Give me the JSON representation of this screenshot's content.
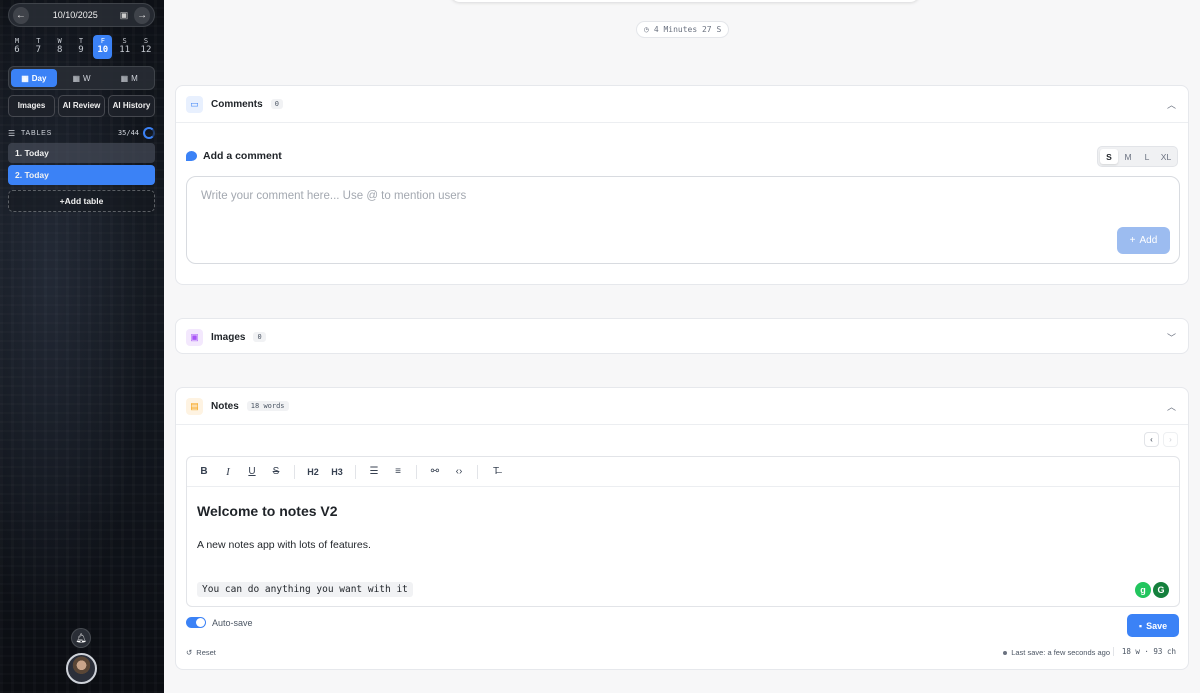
{
  "sidebar": {
    "date": "10/10/2025",
    "weekdays": [
      {
        "letter": "M",
        "num": "6"
      },
      {
        "letter": "T",
        "num": "7"
      },
      {
        "letter": "W",
        "num": "8"
      },
      {
        "letter": "T",
        "num": "9"
      },
      {
        "letter": "F",
        "num": "10"
      },
      {
        "letter": "S",
        "num": "11"
      },
      {
        "letter": "S",
        "num": "12"
      }
    ],
    "view_tabs": {
      "day": "Day",
      "week": "W",
      "month": "M"
    },
    "buttons": {
      "images": "Images",
      "ai_review": "AI Review",
      "ai_history": "AI History"
    },
    "tables_heading": "TABLES",
    "tables_count": "35/44",
    "tables": [
      "1. Today",
      "2. Today"
    ],
    "add_table": "+Add table"
  },
  "timer": "4 Minutes 27 S",
  "comments": {
    "title": "Comments",
    "count": "0",
    "add_heading": "Add a comment",
    "sizes": [
      "S",
      "M",
      "L",
      "XL"
    ],
    "placeholder": "Write your comment here... Use @ to mention users",
    "add_label": "Add"
  },
  "images": {
    "title": "Images",
    "count": "0"
  },
  "notes": {
    "title": "Notes",
    "words_badge": "18 words",
    "toolbar": {
      "h2": "H2",
      "h3": "H3"
    },
    "heading": "Welcome to notes V2",
    "paragraph": "A new notes app with lots of features.",
    "code": "You can do anything you want with it",
    "autosave_label": "Auto-save",
    "save_label": "Save",
    "reset_label": "Reset",
    "last_save": "Last save: a few seconds ago",
    "stats": "18 w · 93 ch"
  },
  "colors": {
    "accent": "#3b82f6"
  }
}
